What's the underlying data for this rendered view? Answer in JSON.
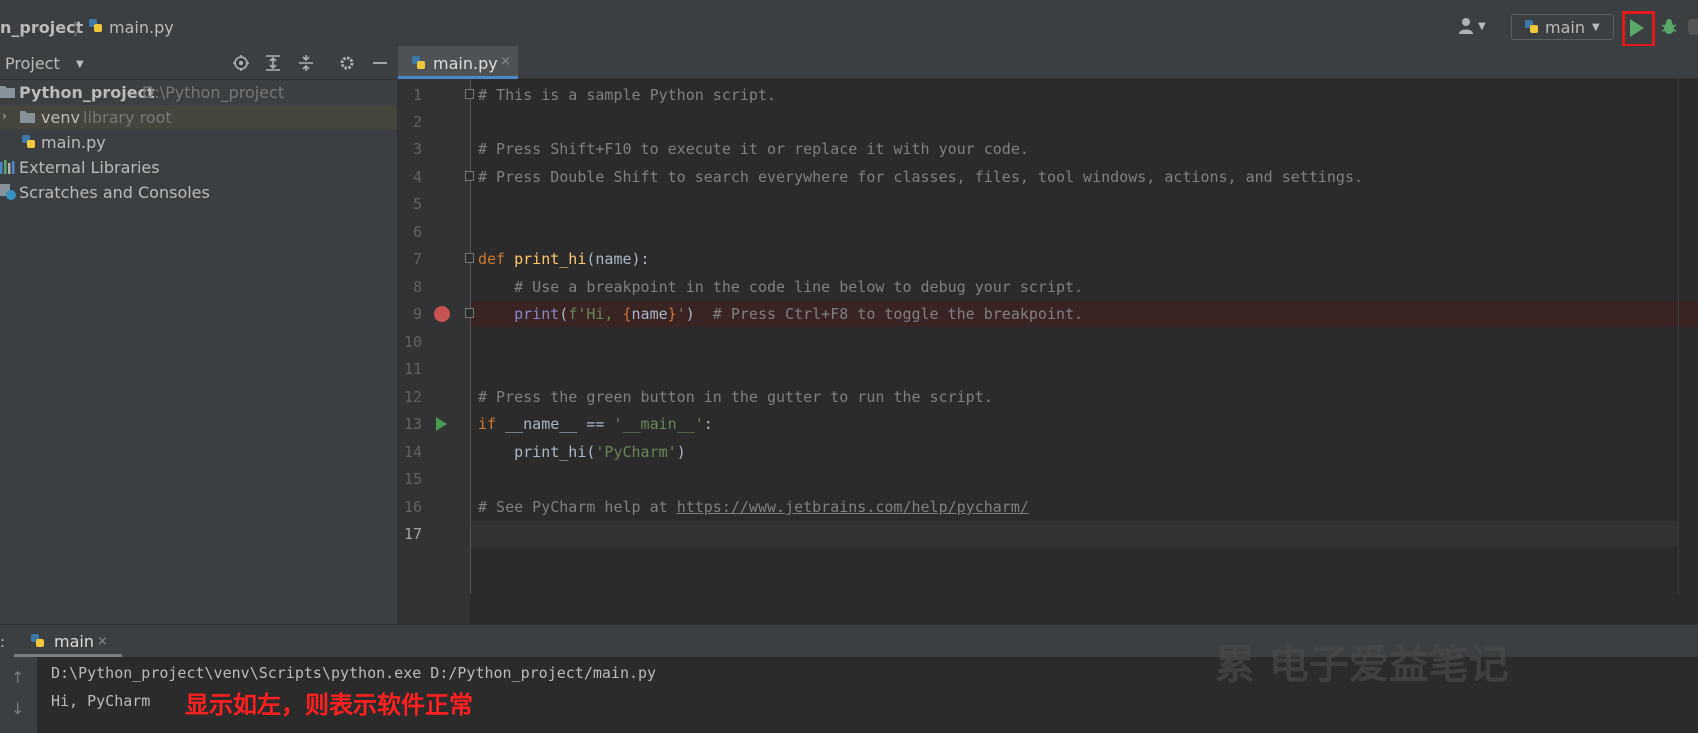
{
  "breadcrumb": {
    "project": "n_project",
    "separator": "〉",
    "file": "main.py"
  },
  "toolbar": {
    "run_config": "main",
    "user_icon": "user-icon",
    "run_icon": "run-icon",
    "debug_icon": "debug-icon"
  },
  "project_panel": {
    "title": "Project",
    "tools": [
      "locate-icon",
      "expand-all-icon",
      "collapse-all-icon",
      "gear-icon",
      "minimize-icon"
    ],
    "tree": [
      {
        "label": "Python_project",
        "hint": "D:\\Python_project",
        "bold": true
      },
      {
        "label": "venv",
        "hint": "library root"
      },
      {
        "label": "main.py",
        "hint": ""
      },
      {
        "label": "External Libraries",
        "hint": ""
      },
      {
        "label": "Scratches and Consoles",
        "hint": ""
      }
    ]
  },
  "editor": {
    "tab_label": "main.py",
    "tab_close": "×",
    "line_numbers": [
      "1",
      "2",
      "3",
      "4",
      "5",
      "6",
      "7",
      "8",
      "9",
      "10",
      "11",
      "12",
      "13",
      "14",
      "15",
      "16",
      "17"
    ],
    "lines": {
      "l1": "# This is a sample Python script.",
      "l3": "# Press Shift+F10 to execute it or replace it with your code.",
      "l4": "# Press Double Shift to search everywhere for classes, files, tool windows, actions, and settings.",
      "l7_kw": "def",
      "l7_fn": "print_hi",
      "l7_rest": "(name):",
      "l8": "    # Use a breakpoint in the code line below to debug your script.",
      "l9_indent": "    ",
      "l9_print": "print",
      "l9_open": "(",
      "l9_str1": "f'Hi, ",
      "l9_brace1": "{",
      "l9_name": "name",
      "l9_brace2": "}",
      "l9_str2": "'",
      "l9_close": ")",
      "l9_comment": "  # Press Ctrl+F8 to toggle the breakpoint.",
      "l12": "# Press the green button in the gutter to run the script.",
      "l13_kw": "if",
      "l13_rest": " __name__ == ",
      "l13_str": "'__main__'",
      "l13_colon": ":",
      "l14_call": "    print_hi(",
      "l14_str": "'PyCharm'",
      "l14_close": ")",
      "l16_comment": "# See PyCharm help at ",
      "l16_link": "https://www.jetbrains.com/help/pycharm/"
    }
  },
  "run_panel": {
    "prefix": ":",
    "tab_label": "main",
    "tab_close": "×",
    "output": [
      "D:\\Python_project\\venv\\Scripts\\python.exe D:/Python_project/main.py",
      "Hi, PyCharm"
    ],
    "annotation": "显示如左，则表示软件正常",
    "watermark": "累 电子爱益笔记"
  },
  "colors": {
    "run_highlight": "#e0191b",
    "run_green": "#59a869",
    "breakpoint": "#c75450",
    "annotation": "#ff2020"
  }
}
